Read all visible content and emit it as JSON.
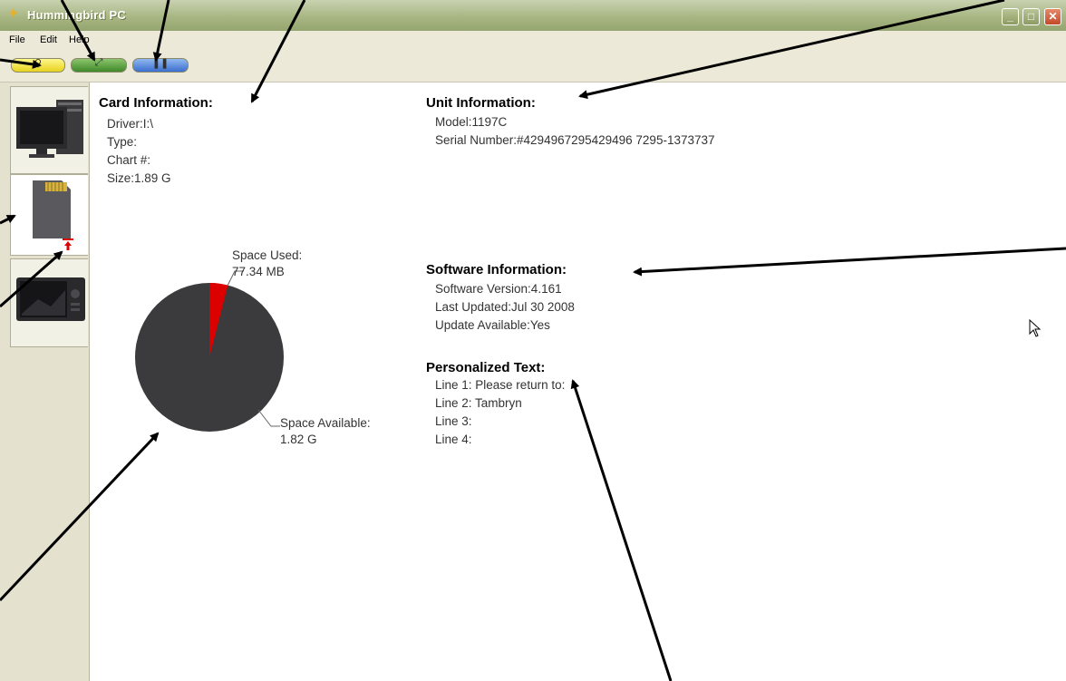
{
  "window": {
    "title": "Hummingbird PC",
    "controls": {
      "minimize": "_",
      "maximize": "□",
      "close": "✕"
    }
  },
  "menu": {
    "items": [
      "File",
      "Edit",
      "Help"
    ]
  },
  "toolbar": {
    "buttons": [
      {
        "icon": "magnify-icon",
        "color": "#e6d21e",
        "glyph": "⚲"
      },
      {
        "icon": "export-icon",
        "color": "#3f8a2a",
        "glyph": "⤢"
      },
      {
        "icon": "pause-icon",
        "color": "#3b6fcf",
        "glyph": "❚❚"
      }
    ]
  },
  "sidebar": {
    "tabs": [
      {
        "icon": "pc-monitor-icon",
        "active": false
      },
      {
        "icon": "sd-card-icon",
        "active": true
      },
      {
        "icon": "fishfinder-unit-icon",
        "active": false
      }
    ]
  },
  "card": {
    "title": "Card Information:",
    "lines": [
      "Driver:I:\\",
      "Type:",
      "Chart #:",
      "Size:1.89 G"
    ]
  },
  "unit": {
    "title": "Unit Information:",
    "lines": [
      "Model:1197C",
      "Serial Number:#4294967295429496 7295-1373737"
    ]
  },
  "software": {
    "title": "Software Information:",
    "lines": [
      "Software Version:4.161",
      "Last Updated:Jul 30 2008",
      "Update Available:Yes"
    ]
  },
  "personalized": {
    "title": "Personalized Text:",
    "lines": [
      "Line 1: Please return to:",
      "Line 2: Tambryn",
      "Line 3:",
      "Line 4:"
    ]
  },
  "pie": {
    "used_label": "Space Used:",
    "used_value": "77.34 MB",
    "available_label": "Space Available:",
    "available_value": "1.82 G",
    "used_fraction": 0.04,
    "colors": {
      "used": "#dd0000",
      "available": "#3b3a3c"
    }
  }
}
